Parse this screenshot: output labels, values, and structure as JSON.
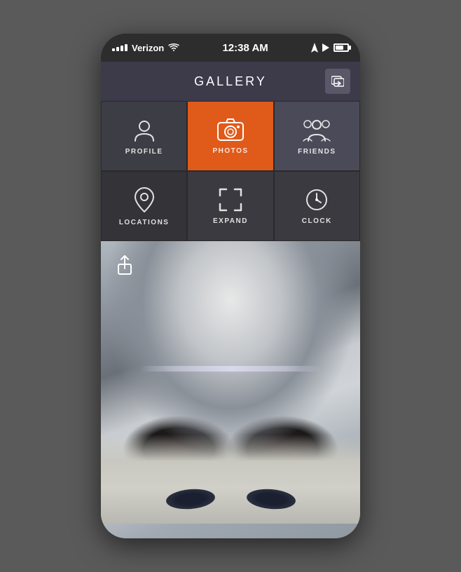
{
  "status_bar": {
    "carrier": "Verizon",
    "time": "12:38 AM",
    "signal_dots": "...",
    "battery_level": 70
  },
  "header": {
    "title": "GALLERY",
    "forward_icon": "forward-icon"
  },
  "grid": {
    "items": [
      {
        "id": "profile",
        "label": "PROFILE",
        "icon": "profile-icon"
      },
      {
        "id": "photos",
        "label": "PHOTOS",
        "icon": "camera-icon",
        "active": true
      },
      {
        "id": "friends",
        "label": "FRIENDS",
        "icon": "friends-icon"
      },
      {
        "id": "locations",
        "label": "LOCATIONS",
        "icon": "location-icon"
      },
      {
        "id": "expand",
        "label": "EXPAND",
        "icon": "expand-icon"
      },
      {
        "id": "clock",
        "label": "CLOCK",
        "icon": "clock-icon"
      }
    ]
  },
  "photo_area": {
    "share_icon": "share-icon",
    "description": "Portrait photo of woman with silver/white hair and headband"
  }
}
